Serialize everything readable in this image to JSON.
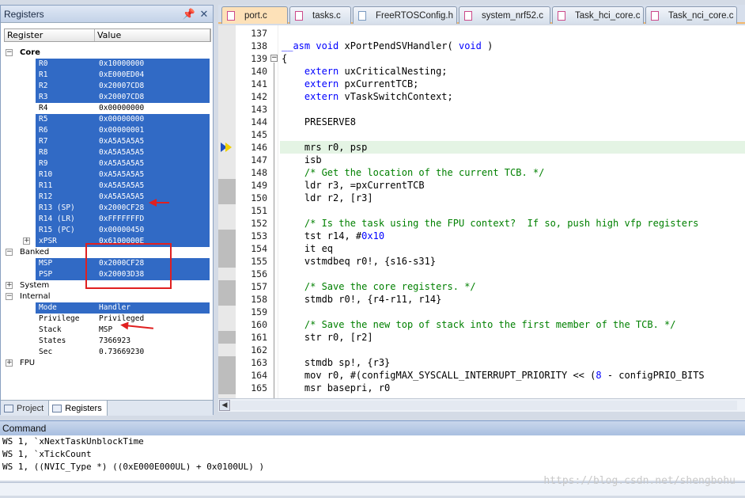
{
  "registers_panel": {
    "title": "Registers",
    "columns": [
      "Register",
      "Value"
    ],
    "groups": {
      "core": "Core",
      "banked": "Banked",
      "system": "System",
      "internal": "Internal",
      "fpu": "FPU"
    },
    "core_rows": [
      {
        "name": "R0",
        "value": "0x10000000",
        "selected": true
      },
      {
        "name": "R1",
        "value": "0xE000ED04",
        "selected": true
      },
      {
        "name": "R2",
        "value": "0x20007CD8",
        "selected": true
      },
      {
        "name": "R3",
        "value": "0x20007CD8",
        "selected": true
      },
      {
        "name": "R4",
        "value": "0x00000000",
        "selected": false
      },
      {
        "name": "R5",
        "value": "0x00000000",
        "selected": true
      },
      {
        "name": "R6",
        "value": "0x00000001",
        "selected": true
      },
      {
        "name": "R7",
        "value": "0xA5A5A5A5",
        "selected": true
      },
      {
        "name": "R8",
        "value": "0xA5A5A5A5",
        "selected": true
      },
      {
        "name": "R9",
        "value": "0xA5A5A5A5",
        "selected": true
      },
      {
        "name": "R10",
        "value": "0xA5A5A5A5",
        "selected": true
      },
      {
        "name": "R11",
        "value": "0xA5A5A5A5",
        "selected": true
      },
      {
        "name": "R12",
        "value": "0xA5A5A5A5",
        "selected": true
      },
      {
        "name": "R13 (SP)",
        "value": "0x2000CF28",
        "selected": true
      },
      {
        "name": "R14 (LR)",
        "value": "0xFFFFFFFD",
        "selected": true
      },
      {
        "name": "R15 (PC)",
        "value": "0x00000450",
        "selected": true
      },
      {
        "name": "xPSR",
        "value": "0x6100000E",
        "selected": true
      }
    ],
    "banked_rows": [
      {
        "name": "MSP",
        "value": "0x2000CF28",
        "selected": true
      },
      {
        "name": "PSP",
        "value": "0x20003D38",
        "selected": true
      }
    ],
    "internal_rows": [
      {
        "name": "Mode",
        "value": "Handler",
        "selected": true
      },
      {
        "name": "Privilege",
        "value": "Privileged",
        "selected": false
      },
      {
        "name": "Stack",
        "value": "MSP",
        "selected": false
      },
      {
        "name": "States",
        "value": "7366923",
        "selected": false
      },
      {
        "name": "Sec",
        "value": "0.73669230",
        "selected": false
      }
    ],
    "bottom_tabs": [
      "Project",
      "Registers"
    ]
  },
  "editor": {
    "tabs": [
      {
        "label": "port.c",
        "active": true,
        "kind": "c"
      },
      {
        "label": "tasks.c",
        "active": false,
        "kind": "c"
      },
      {
        "label": "FreeRTOSConfig.h",
        "active": false,
        "kind": "h"
      },
      {
        "label": "system_nrf52.c",
        "active": false,
        "kind": "c"
      },
      {
        "label": "Task_hci_core.c",
        "active": false,
        "kind": "c"
      },
      {
        "label": "Task_nci_core.c",
        "active": false,
        "kind": "c"
      }
    ],
    "current_line": 146,
    "lines": [
      {
        "no": "137",
        "text": ""
      },
      {
        "no": "138",
        "text": "__asm void xPortPendSVHandler( void )"
      },
      {
        "no": "139",
        "text": "{"
      },
      {
        "no": "140",
        "text": "    extern uxCriticalNesting;"
      },
      {
        "no": "141",
        "text": "    extern pxCurrentTCB;"
      },
      {
        "no": "142",
        "text": "    extern vTaskSwitchContext;"
      },
      {
        "no": "143",
        "text": ""
      },
      {
        "no": "144",
        "text": "    PRESERVE8"
      },
      {
        "no": "145",
        "text": ""
      },
      {
        "no": "146",
        "text": "    mrs r0, psp"
      },
      {
        "no": "147",
        "text": "    isb"
      },
      {
        "no": "148",
        "text": "    /* Get the location of the current TCB. */"
      },
      {
        "no": "149",
        "text": "    ldr r3, =pxCurrentTCB"
      },
      {
        "no": "150",
        "text": "    ldr r2, [r3]"
      },
      {
        "no": "151",
        "text": ""
      },
      {
        "no": "152",
        "text": "    /* Is the task using the FPU context?  If so, push high vfp registers"
      },
      {
        "no": "153",
        "text": "    tst r14, #0x10"
      },
      {
        "no": "154",
        "text": "    it eq"
      },
      {
        "no": "155",
        "text": "    vstmdbeq r0!, {s16-s31}"
      },
      {
        "no": "156",
        "text": ""
      },
      {
        "no": "157",
        "text": "    /* Save the core registers. */"
      },
      {
        "no": "158",
        "text": "    stmdb r0!, {r4-r11, r14}"
      },
      {
        "no": "159",
        "text": ""
      },
      {
        "no": "160",
        "text": "    /* Save the new top of stack into the first member of the TCB. */"
      },
      {
        "no": "161",
        "text": "    str r0, [r2]"
      },
      {
        "no": "162",
        "text": ""
      },
      {
        "no": "163",
        "text": "    stmdb sp!, {r3}"
      },
      {
        "no": "164",
        "text": "    mov r0, #(configMAX_SYSCALL_INTERRUPT_PRIORITY << (8 - configPRIO_BITS"
      },
      {
        "no": "165",
        "text": "    msr basepri, r0"
      }
    ]
  },
  "command": {
    "title": "Command",
    "lines": [
      "WS 1, `xNextTaskUnblockTime",
      "WS 1, `xTickCount",
      "WS 1, ((NVIC_Type *) ((0xE000E000UL) + 0x0100UL) )"
    ]
  },
  "watermark": "https://blog.csdn.net/shengbohu",
  "colors": {
    "selection": "#316ac5",
    "annotation": "#e02020",
    "active_tab": "#fde1b8"
  }
}
